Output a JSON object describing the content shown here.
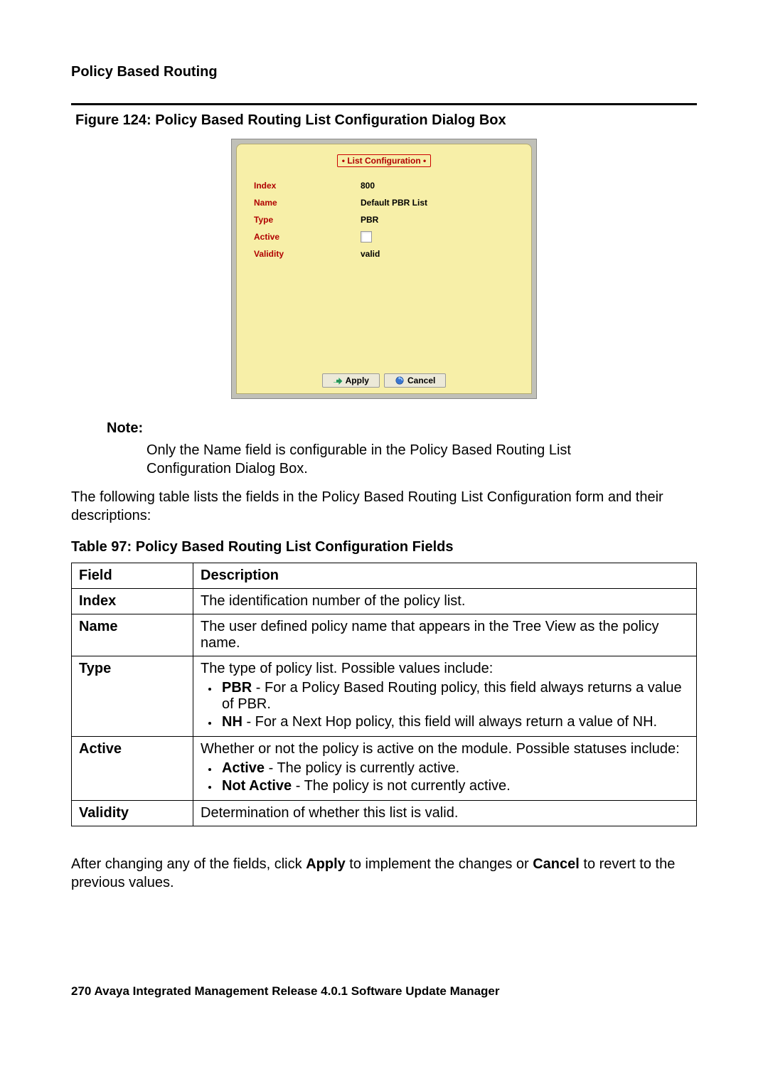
{
  "header": {
    "section": "Policy Based Routing"
  },
  "figure": {
    "caption": "Figure 124: Policy Based Routing List Configuration Dialog Box"
  },
  "dialog": {
    "title": "• List Configuration •",
    "fields": {
      "index": {
        "label": "Index",
        "value": "800"
      },
      "name": {
        "label": "Name",
        "value": "Default PBR List"
      },
      "type": {
        "label": "Type",
        "value": "PBR"
      },
      "active": {
        "label": "Active"
      },
      "validity": {
        "label": "Validity",
        "value": "valid"
      }
    },
    "buttons": {
      "apply": "Apply",
      "cancel": "Cancel"
    }
  },
  "note": {
    "title": "Note:",
    "body": "Only the Name field is configurable in the Policy Based Routing List Configuration Dialog Box."
  },
  "intro_text": "The following table lists the fields in the Policy Based Routing List Configuration form and their descriptions:",
  "table": {
    "caption": "Table 97: Policy Based Routing List Configuration Fields",
    "header": {
      "field": "Field",
      "description": "Description"
    },
    "rows": {
      "index": {
        "field": "Index",
        "desc": "The identification number of the policy list."
      },
      "name": {
        "field": "Name",
        "desc": "The user defined policy name that appears in the Tree View as the policy name."
      },
      "type": {
        "field": "Type",
        "intro": "The type of policy list. Possible values include:",
        "b1_strong": "PBR",
        "b1_rest": " - For a Policy Based Routing policy, this field always returns a value of PBR.",
        "b2_strong": "NH",
        "b2_rest": " - For a Next Hop policy, this field will always return a value of NH."
      },
      "active": {
        "field": "Active",
        "intro": "Whether or not the policy is active on the module. Possible statuses include:",
        "b1_strong": "Active",
        "b1_rest": " - The policy is currently active.",
        "b2_strong": "Not Active",
        "b2_rest": " - The policy is not currently active."
      },
      "validity": {
        "field": "Validity",
        "desc": "Determination of whether this list is valid."
      }
    }
  },
  "closing": {
    "pre": "After changing any of the fields, click ",
    "apply": "Apply",
    "mid": " to implement the changes or ",
    "cancel": "Cancel",
    "post": " to revert to the previous values."
  },
  "footer": {
    "page": "270",
    "sep": "   ",
    "title": "Avaya Integrated Management Release 4.0.1 Software Update Manager"
  }
}
